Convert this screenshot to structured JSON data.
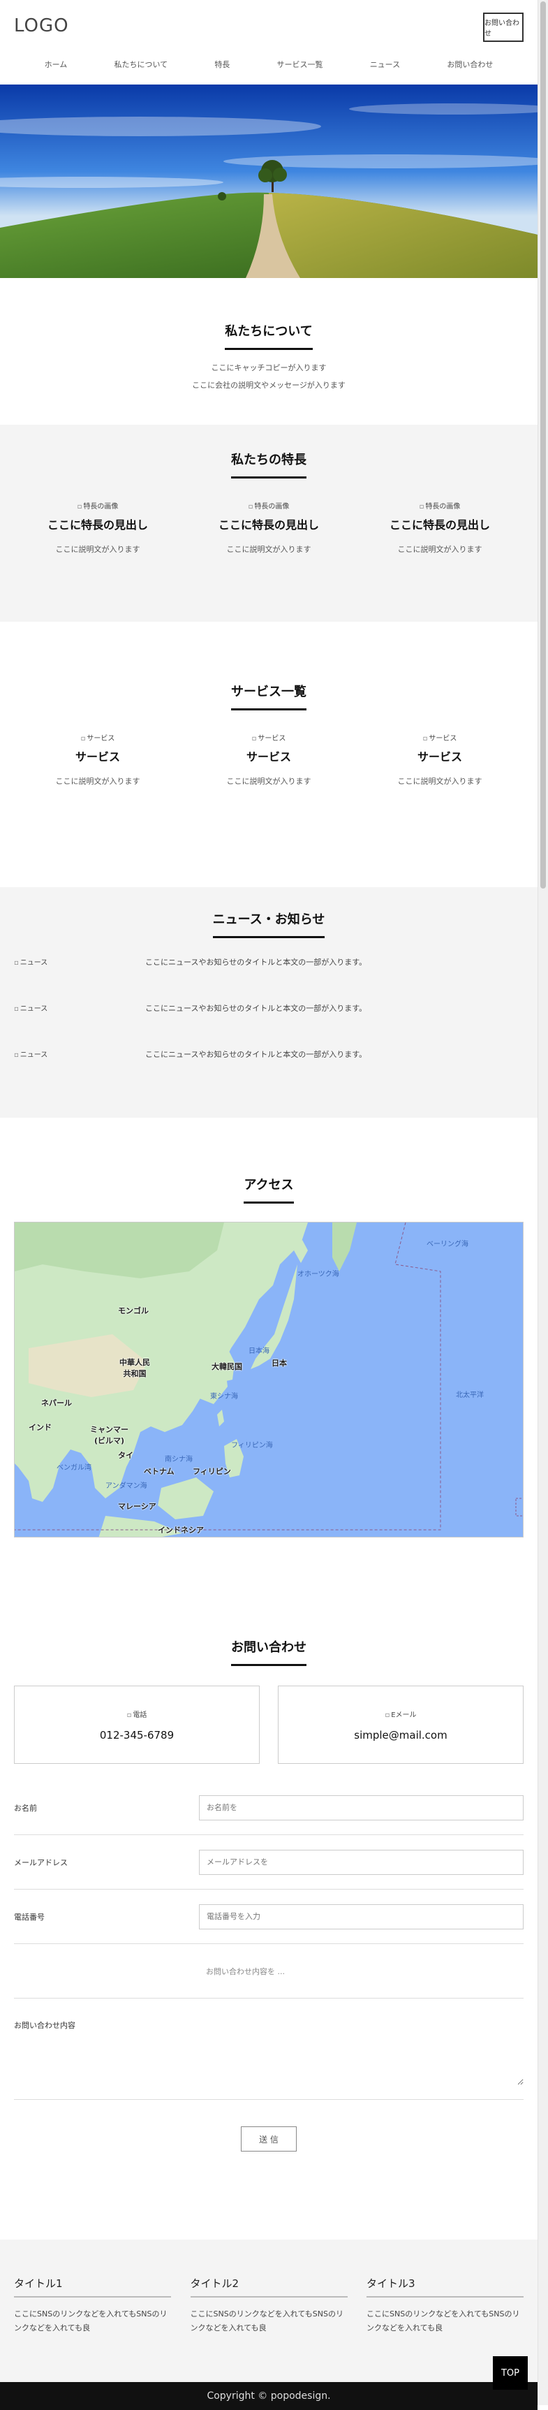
{
  "header": {
    "logo": "LOGO",
    "button_label": "お問い合わせ",
    "nav": [
      "ホーム",
      "私たちについて",
      "特長",
      "サービス一覧",
      "ニュース",
      "お問い合わせ"
    ]
  },
  "about": {
    "title": "私たちについて",
    "lines": [
      "ここにキャッチコピーが入ります",
      "ここに会社の説明文やメッセージが入ります"
    ]
  },
  "features": {
    "title": "私たちの特長",
    "items": [
      {
        "img_alt": "特長の画像",
        "heading": "ここに特長の見出し",
        "text": "ここに説明文が入ります"
      },
      {
        "img_alt": "特長の画像",
        "heading": "ここに特長の見出し",
        "text": "ここに説明文が入ります"
      },
      {
        "img_alt": "特長の画像",
        "heading": "ここに特長の見出し",
        "text": "ここに説明文が入ります"
      }
    ]
  },
  "services": {
    "title": "サービス一覧",
    "items": [
      {
        "img_alt": "サービス",
        "heading": "サービス",
        "text": "ここに説明文が入ります"
      },
      {
        "img_alt": "サービス",
        "heading": "サービス",
        "text": "ここに説明文が入ります"
      },
      {
        "img_alt": "サービス",
        "heading": "サービス",
        "text": "ここに説明文が入ります"
      }
    ]
  },
  "news": {
    "title": "ニュース・お知らせ",
    "items": [
      {
        "img_alt": "ニュース",
        "text": "ここにニュースやお知らせのタイトルと本文の一部が入ります。"
      },
      {
        "img_alt": "ニュース",
        "text": "ここにニュースやお知らせのタイトルと本文の一部が入ります。"
      },
      {
        "img_alt": "ニュース",
        "text": "ここにニュースやお知らせのタイトルと本文の一部が入ります。"
      }
    ]
  },
  "access": {
    "title": "アクセス",
    "map_labels": {
      "mongolia": "モンゴル",
      "china": "中華人民\n共和国",
      "korea": "大韓民国",
      "japan": "日本",
      "nepal": "ネパール",
      "india": "インド",
      "myanmar": "ミャンマー\n(ビルマ)",
      "thailand": "タイ",
      "vietnam": "ベトナム",
      "philippines": "フィリピン",
      "malaysia": "マレーシア",
      "indonesia": "インドネシア",
      "sea_okhotsk": "オホーツク海",
      "sea_bering": "ベーリング海",
      "sea_japan": "日本海",
      "sea_east_china": "東シナ海",
      "sea_philippine": "フィリピン海",
      "sea_south_china": "南シナ海",
      "pacific": "北太平洋",
      "bay_bengal": "ベンガル湾",
      "andaman": "アンダマン海"
    }
  },
  "contact": {
    "title": "お問い合わせ",
    "phone": {
      "img_alt": "電話",
      "value": "012-345-6789"
    },
    "email": {
      "img_alt": "Eメール",
      "value": "simple@mail.com"
    },
    "form": {
      "name_label": "お名前",
      "name_placeholder": "お名前を",
      "email_label": "メールアドレス",
      "email_placeholder": "メールアドレスを",
      "phone_label": "電話番号",
      "phone_placeholder": "電話番号を入力",
      "select_value": "お問い合わせ内容を ...",
      "message_label": "お問い合わせ内容",
      "submit_label": "送 信"
    }
  },
  "footer": {
    "columns": [
      {
        "title": "タイトル1",
        "text": "ここにSNSのリンクなどを入れてもSNSのリンクなどを入れても良"
      },
      {
        "title": "タイトル2",
        "text": "ここにSNSのリンクなどを入れてもSNSのリンクなどを入れても良"
      },
      {
        "title": "タイトル3",
        "text": "ここにSNSのリンクなどを入れてもSNSのリンクなどを入れても良"
      }
    ],
    "copyright": "Copyright © popodesign.",
    "top_button": "TOP"
  }
}
